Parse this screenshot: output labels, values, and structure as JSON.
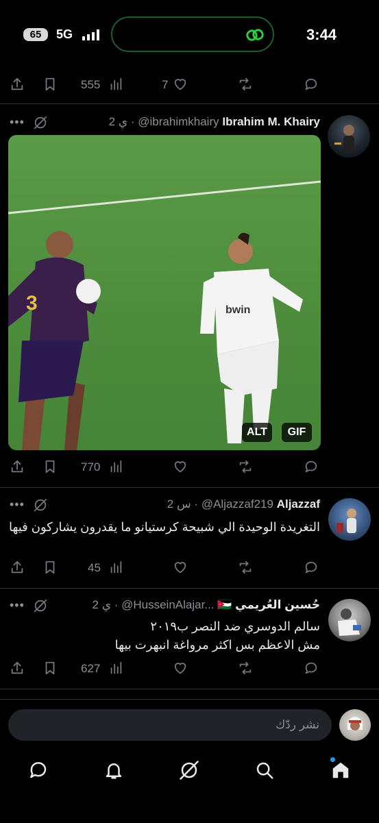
{
  "status_bar": {
    "battery": "65",
    "network": "5G",
    "time": "3:44"
  },
  "top_actions": {
    "views": "555",
    "likes": "7"
  },
  "tweets": [
    {
      "author": "Ibrahim M. Khairy",
      "handle": "@ibrahimkhairy",
      "time": "2 ي",
      "media_badges": [
        "ALT",
        "GIF"
      ],
      "views": "770",
      "likes": ""
    },
    {
      "author": "Aljazzaf",
      "handle": "@Aljazzaf219",
      "time": "2 س",
      "text": "التغريدة الوحيدة الي شبيحة كرستيانو ما يقدرون يشاركون فيها",
      "views": "45"
    },
    {
      "author": "حُسين العُريمي",
      "flag": "🇯🇴",
      "handle": "@HusseinAlajar...",
      "time": "2 ي",
      "text_line1": "سالم الدوسري ضد النصر ب٢٠١٩",
      "text_line2": "مش الاعظم بس اكثر مرواغة انبهرت بيها",
      "views": "627"
    }
  ],
  "reply_box": {
    "placeholder": "نشر ردّك"
  },
  "bottom_nav": [
    "messages-icon",
    "notifications-icon",
    "grok-icon",
    "search-icon",
    "home-icon"
  ],
  "colors": {
    "accent": "#1d9bf0",
    "pill_border": "#1f5e2a",
    "pill_icon": "#2ecc40"
  }
}
